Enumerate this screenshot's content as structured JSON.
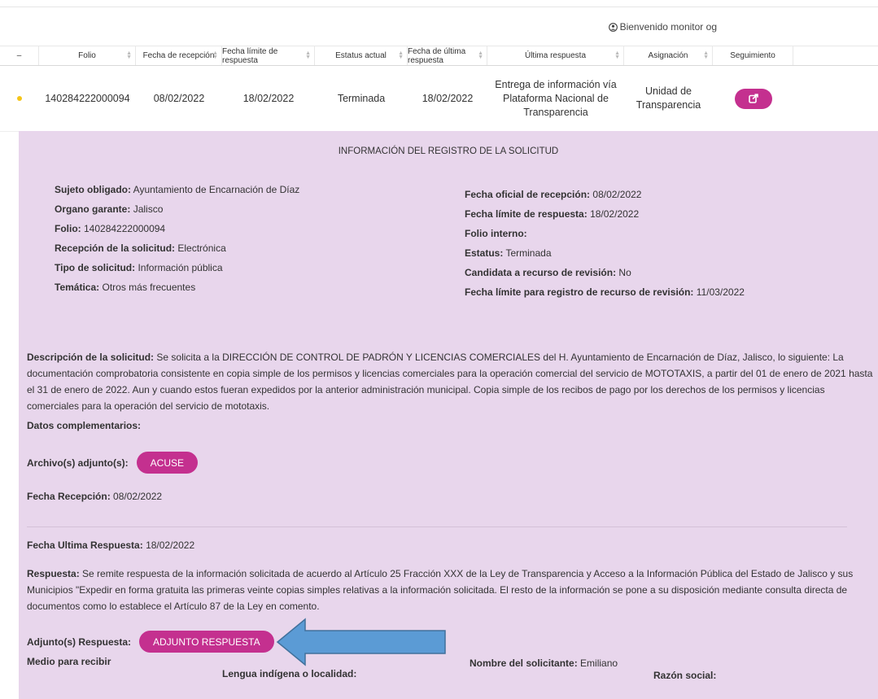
{
  "header": {
    "welcome": "Bienvenido monitor og"
  },
  "table": {
    "columns": [
      "–",
      "Folio",
      "Fecha de recepción",
      "Fecha límite de respuesta",
      "Estatus actual",
      "Fecha de última respuesta",
      "Última respuesta",
      "Asignación",
      "Seguimiento"
    ],
    "row": {
      "folio": "140284222000094",
      "fecha_recepcion": "08/02/2022",
      "fecha_limite": "18/02/2022",
      "estatus": "Terminada",
      "fecha_ultima": "18/02/2022",
      "ultima_respuesta_lines": [
        "Entrega de información vía",
        "Plataforma Nacional de",
        "Transparencia"
      ],
      "asignacion_lines": [
        "Unidad de",
        "Transparencia"
      ]
    }
  },
  "detail": {
    "title": "INFORMACIÓN DEL REGISTRO DE LA SOLICITUD",
    "left": [
      {
        "label": "Sujeto obligado:",
        "value": "Ayuntamiento de Encarnación de Díaz"
      },
      {
        "label": "Organo garante:",
        "value": "Jalisco"
      },
      {
        "label": "Folio:",
        "value": "140284222000094"
      },
      {
        "label": "Recepción de la solicitud:",
        "value": "Electrónica"
      },
      {
        "label": "Tipo de solicitud:",
        "value": "Información pública"
      },
      {
        "label": "Temática:",
        "value": "Otros más frecuentes"
      }
    ],
    "right": [
      {
        "label": "Fecha oficial de recepción:",
        "value": "08/02/2022"
      },
      {
        "label": "Fecha límite de respuesta:",
        "value": "18/02/2022"
      },
      {
        "label": "Folio interno:",
        "value": ""
      },
      {
        "label": "Estatus:",
        "value": "Terminada"
      },
      {
        "label": "Candidata a recurso de revisión:",
        "value": "No"
      },
      {
        "label": "Fecha límite para registro de recurso de revisión:",
        "value": "11/03/2022"
      }
    ],
    "descripcion_label": "Descripción de la solicitud:",
    "descripcion": "Se solicita a la DIRECCIÓN DE CONTROL DE PADRÓN Y LICENCIAS COMERCIALES del H. Ayuntamiento de Encarnación de Díaz, Jalisco, lo siguiente: La documentación comprobatoria consistente en copia simple de los permisos y licencias comerciales para la operación comercial del servicio de MOTOTAXIS, a partir del 01 de enero de 2021 hasta el 31 de enero de 2022. Aun y cuando estos fueran expedidos por la anterior administración municipal. Copia simple de los recibos de pago por los derechos de los permisos y licencias comerciales para la operación del servicio de mototaxis.",
    "datos_complementarios": "Datos complementarios:",
    "archivo_label": "Archivo(s) adjunto(s):",
    "acuse_button": "ACUSE",
    "fecha_recepcion_label": "Fecha Recepción:",
    "fecha_recepcion": "08/02/2022",
    "fecha_ultima_label": "Fecha Ultima Respuesta:",
    "fecha_ultima": "18/02/2022",
    "respuesta_label": "Respuesta:",
    "respuesta": "Se remite respuesta de la información solicitada de acuerdo al Artículo 25 Fracción XXX de la Ley de Transparencia y Acceso a la Información Pública del Estado de Jalisco y sus Municipios \"Expedir en forma gratuita las primeras veinte copias simples relativas a la información solicitada. El resto de la información se pone a su disposición mediante consulta directa de documentos como lo establece el Artículo 87 de la Ley en comento.",
    "adjunto_label": "Adjunto(s) Respuesta:",
    "adjunto_button": "ADJUNTO RESPUESTA",
    "medio_label": "Medio para recibir",
    "lengua_label": "Lengua indígena o localidad:",
    "nombre_label": "Nombre del solicitante:",
    "nombre_value": "Emiliano",
    "razon_label": "Razón social:"
  },
  "colors": {
    "accent": "#c4308f",
    "panel": "#e8d6ec",
    "arrow": "#5b9bd5"
  }
}
